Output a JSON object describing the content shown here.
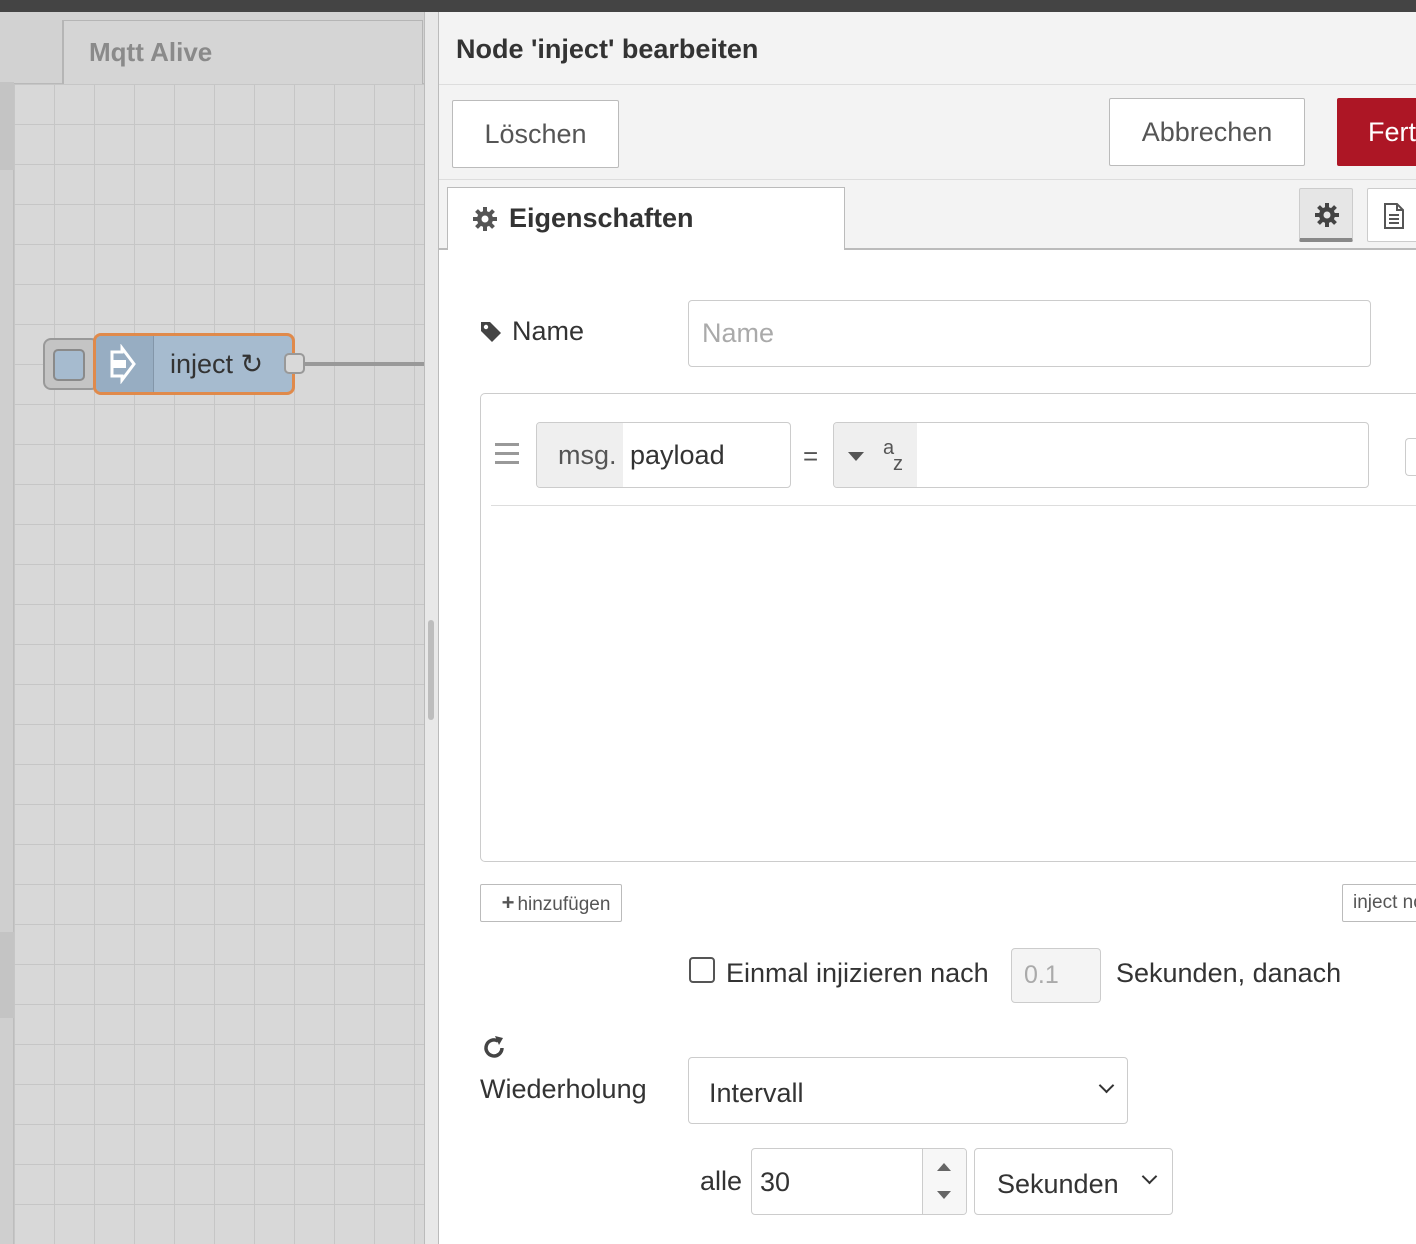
{
  "workspace": {
    "flow_tab_label": "Mqtt Alive",
    "node_label": "inject ↻",
    "node_color": "#a6bbcf",
    "selected_outline_color": "#e08a4b"
  },
  "tray": {
    "title": "Node 'inject' bearbeiten",
    "delete_label": "Löschen",
    "cancel_label": "Abbrechen",
    "done_label": "Fertig",
    "done_color": "#ad1625",
    "tabs": [
      {
        "label": "Eigenschaften",
        "icon": "gear-icon"
      }
    ],
    "tab_icon_buttons": [
      "gear-icon",
      "document-icon"
    ]
  },
  "form": {
    "name_label": "Name",
    "name_placeholder": "Name",
    "name_value": "",
    "properties": [
      {
        "prefix": "msg.",
        "property": "payload",
        "operator": "=",
        "type_icon": "string-az-icon",
        "value": ""
      }
    ],
    "add_label": "hinzufügen",
    "inject_now_label": "inject now",
    "once_label": "Einmal injizieren nach",
    "once_checked": false,
    "once_delay": "0.1",
    "after_label": "Sekunden, danach",
    "repeat_label": "Wiederholung",
    "repeat_value": "Intervall",
    "every_label": "alle",
    "interval_value": "30",
    "unit_value": "Sekunden"
  }
}
